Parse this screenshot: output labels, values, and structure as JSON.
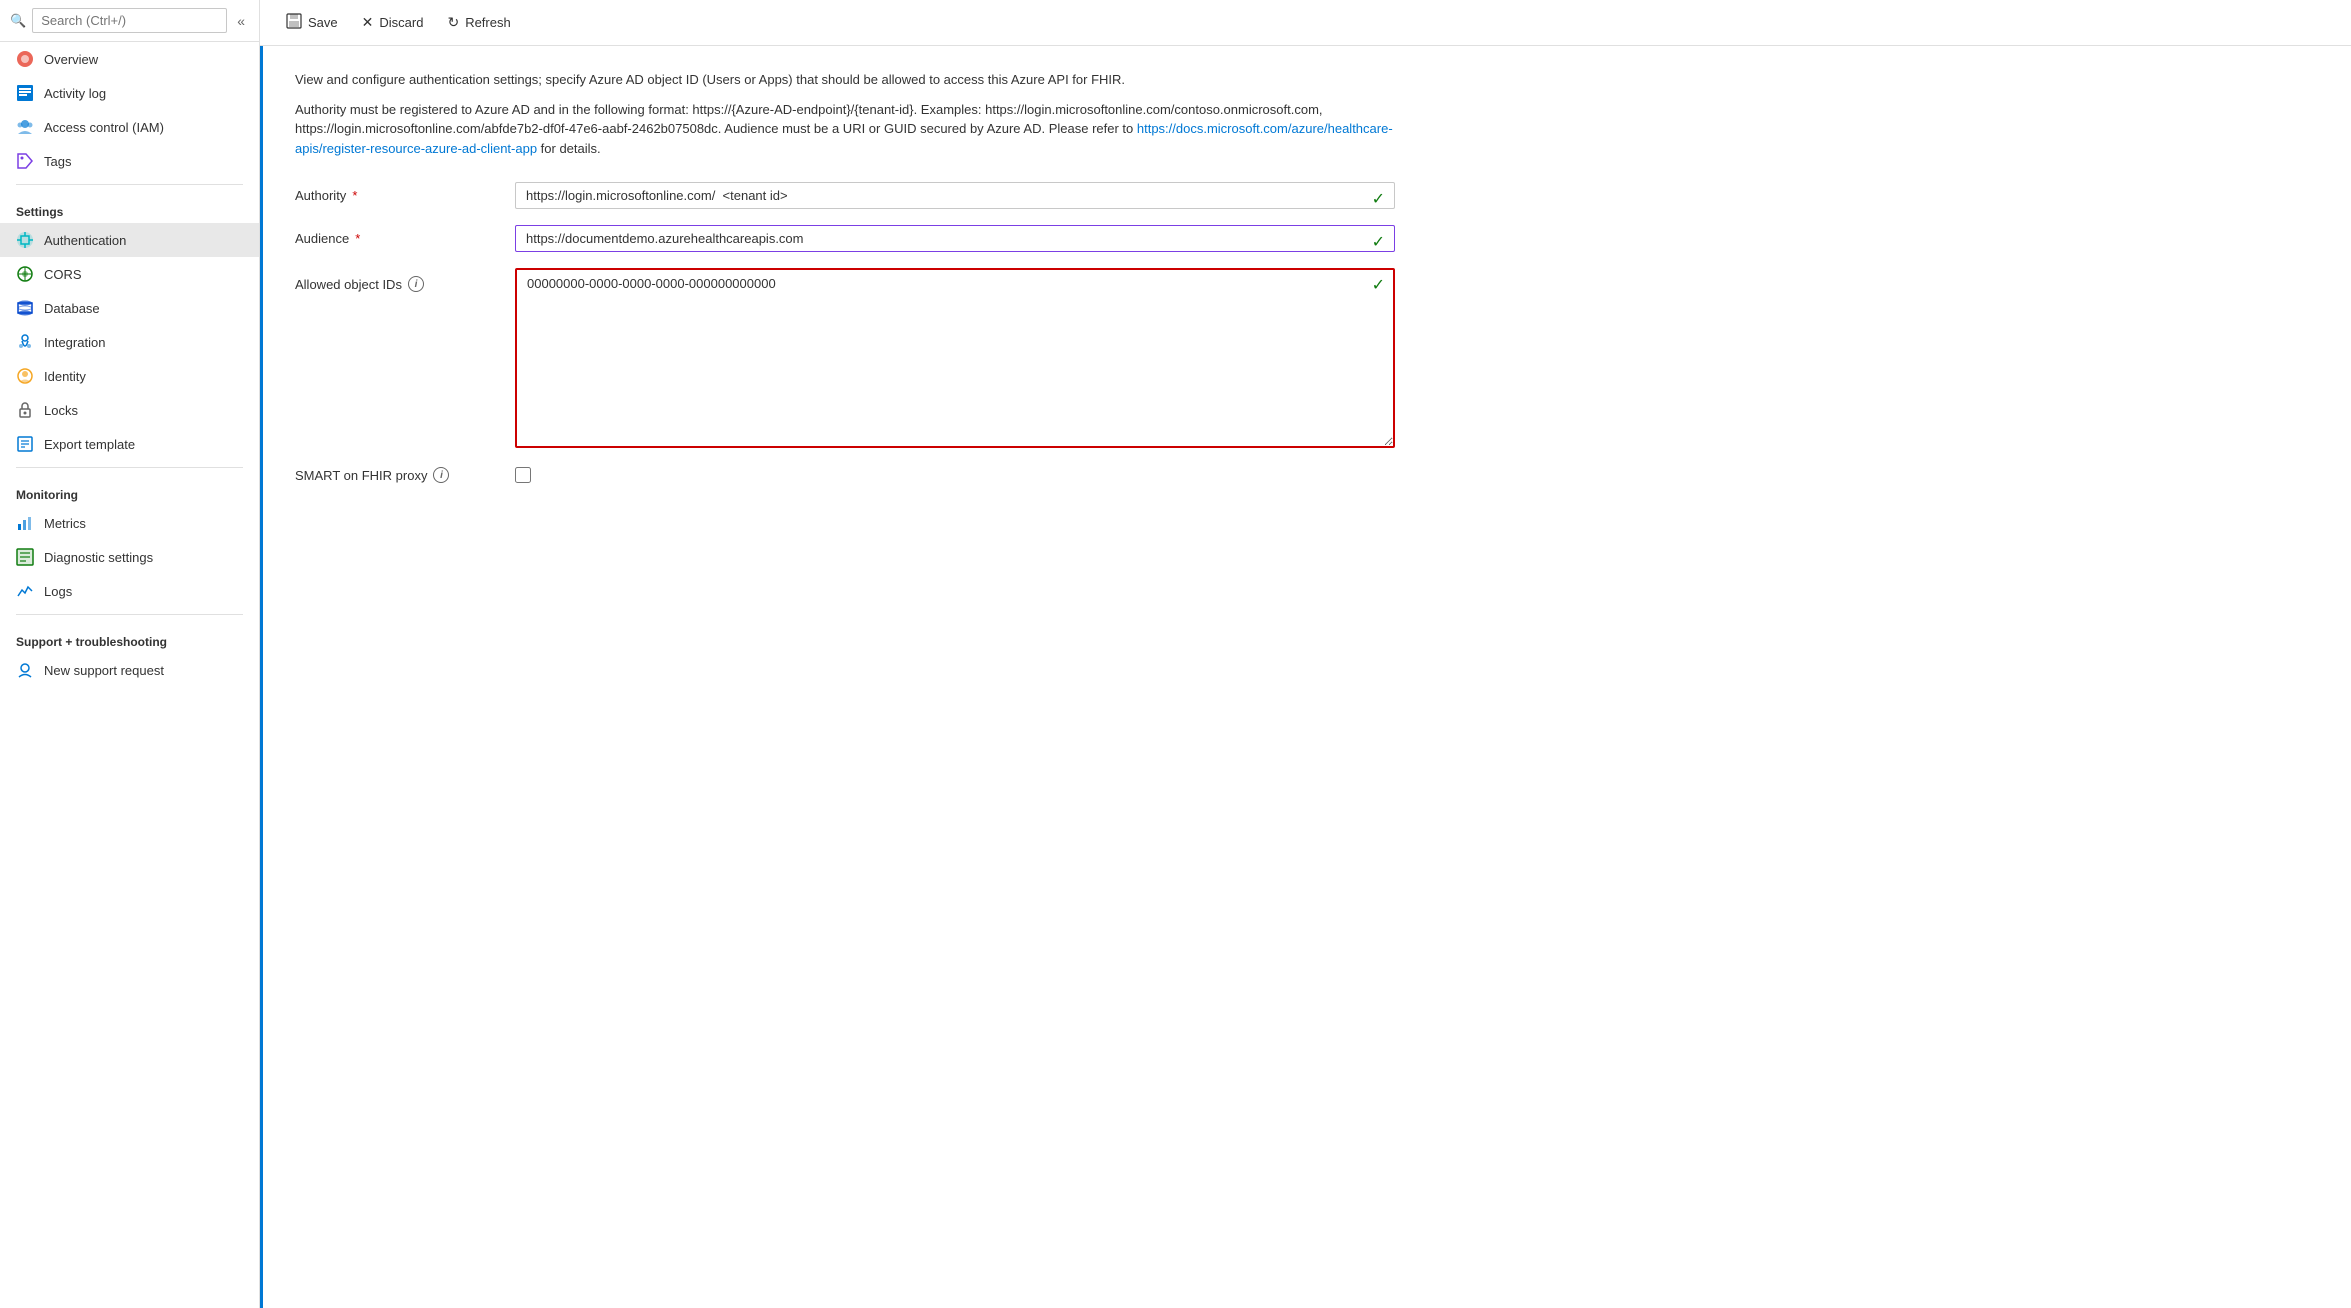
{
  "sidebar": {
    "search_placeholder": "Search (Ctrl+/)",
    "collapse_icon": "«",
    "nav_items_top": [
      {
        "id": "overview",
        "label": "Overview",
        "icon": "🧡",
        "icon_class": "icon-orange"
      },
      {
        "id": "activity-log",
        "label": "Activity log",
        "icon": "▣",
        "icon_class": "icon-blue"
      },
      {
        "id": "access-control",
        "label": "Access control (IAM)",
        "icon": "👤",
        "icon_class": "icon-blue2"
      },
      {
        "id": "tags",
        "label": "Tags",
        "icon": "🏷",
        "icon_class": "icon-purple"
      }
    ],
    "settings_label": "Settings",
    "settings_items": [
      {
        "id": "authentication",
        "label": "Authentication",
        "icon": "◈",
        "icon_class": "icon-cyan",
        "active": true
      },
      {
        "id": "cors",
        "label": "CORS",
        "icon": "⊛",
        "icon_class": "icon-green"
      },
      {
        "id": "database",
        "label": "Database",
        "icon": "🗄",
        "icon_class": "icon-darkblue"
      },
      {
        "id": "integration",
        "label": "Integration",
        "icon": "☁",
        "icon_class": "icon-blue"
      },
      {
        "id": "identity",
        "label": "Identity",
        "icon": "⚙",
        "icon_class": "icon-yellow"
      },
      {
        "id": "locks",
        "label": "Locks",
        "icon": "🔒",
        "icon_class": "icon-gray"
      },
      {
        "id": "export-template",
        "label": "Export template",
        "icon": "▤",
        "icon_class": "icon-blue"
      }
    ],
    "monitoring_label": "Monitoring",
    "monitoring_items": [
      {
        "id": "metrics",
        "label": "Metrics",
        "icon": "📊",
        "icon_class": "icon-blue"
      },
      {
        "id": "diagnostic-settings",
        "label": "Diagnostic settings",
        "icon": "⊞",
        "icon_class": "icon-green"
      },
      {
        "id": "logs",
        "label": "Logs",
        "icon": "📉",
        "icon_class": "icon-blue"
      }
    ],
    "support_label": "Support + troubleshooting",
    "support_items": [
      {
        "id": "new-support-request",
        "label": "New support request",
        "icon": "👤",
        "icon_class": "icon-blue"
      }
    ]
  },
  "toolbar": {
    "save_label": "Save",
    "discard_label": "Discard",
    "refresh_label": "Refresh"
  },
  "main": {
    "description1": "View and configure authentication settings; specify Azure AD object ID (Users or Apps) that should be allowed to access this Azure API for FHIR.",
    "description2_part1": "Authority must be registered to Azure AD and in the following format: https://{Azure-AD-endpoint}/{tenant-id}. Examples: https://login.microsoftonline.com/contoso.onmicrosoft.com, https://login.microsoftonline.com/abfde7b2-df0f-47e6-aabf-2462b07508dc. Audience must be a URI or GUID secured by Azure AD. Please refer to ",
    "description2_link_text": "https://docs.microsoft.com/azure/healthcare-apis/register-resource-azure-ad-client-app",
    "description2_link_href": "https://docs.microsoft.com/azure/healthcare-apis/register-resource-azure-ad-client-app",
    "description2_part2": " for details.",
    "authority_label": "Authority",
    "authority_value": "https://login.microsoftonline.com/  <tenant id>",
    "audience_label": "Audience",
    "audience_value": "https://documentdemo.azurehealthcareapis.com",
    "allowed_object_ids_label": "Allowed object IDs",
    "allowed_object_ids_value": "00000000-0000-0000-0000-000000000000",
    "smart_fhir_label": "SMART on FHIR proxy"
  }
}
